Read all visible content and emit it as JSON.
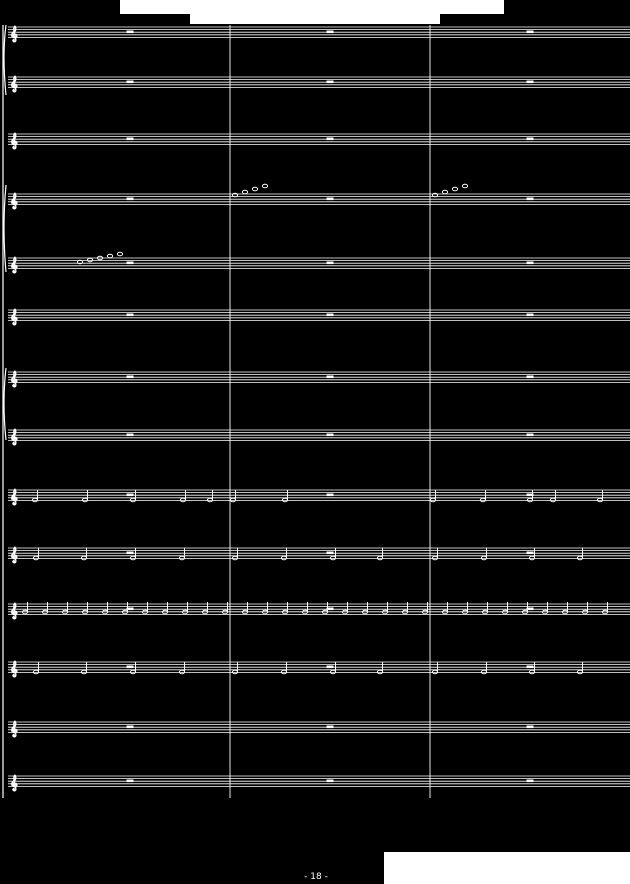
{
  "page": {
    "number": "- 18 -"
  },
  "score": {
    "systems": 13,
    "measures_per_system": 3,
    "ink_color": "#ffffff",
    "background_color": "#000000"
  }
}
